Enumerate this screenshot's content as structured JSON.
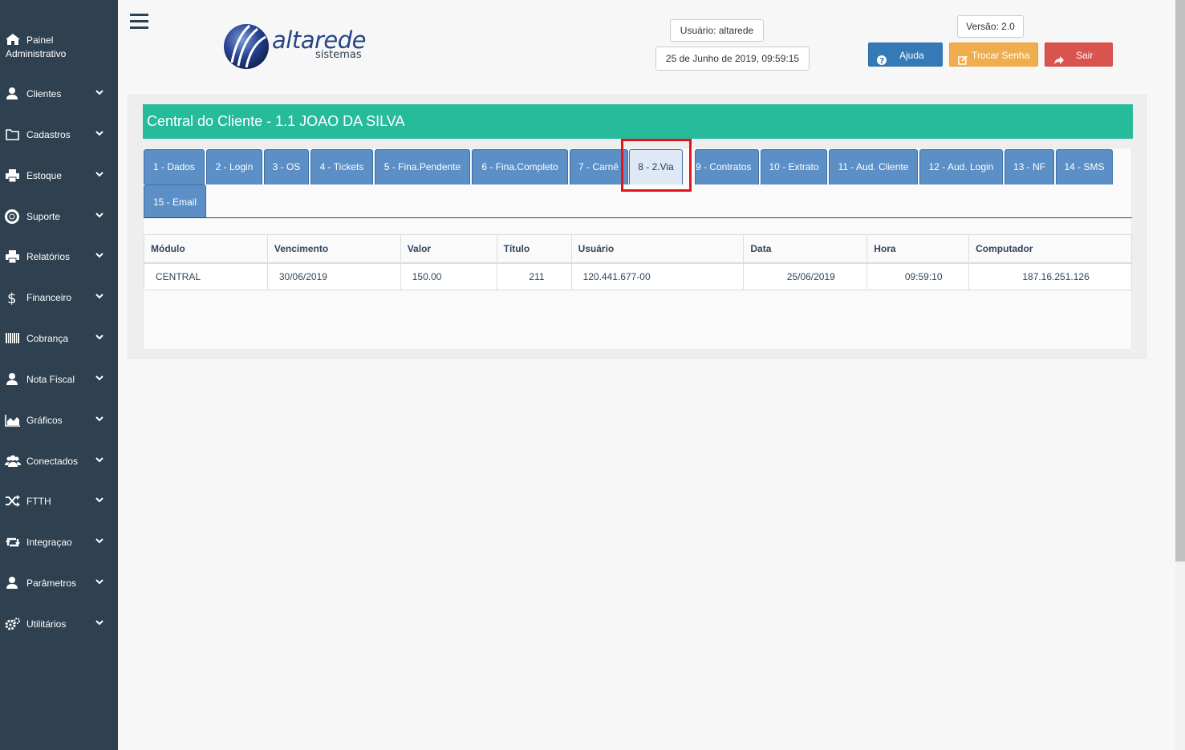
{
  "sidebar": {
    "home": {
      "line1": "Painel",
      "line2": "Administrativo",
      "icon": "home-icon"
    },
    "items": [
      {
        "label": "Clientes",
        "icon": "user-icon"
      },
      {
        "label": "Cadastros",
        "icon": "folder-icon"
      },
      {
        "label": "Estoque",
        "icon": "printer-icon"
      },
      {
        "label": "Suporte",
        "icon": "lifebuoy-icon"
      },
      {
        "label": "Relatórios",
        "icon": "printer-icon"
      },
      {
        "label": "Financeiro",
        "icon": "dollar-icon"
      },
      {
        "label": "Cobrança",
        "icon": "barcode-icon"
      },
      {
        "label": "Nota Fiscal",
        "icon": "user-icon"
      },
      {
        "label": "Gráficos",
        "icon": "area-chart-icon"
      },
      {
        "label": "Conectados",
        "icon": "users-icon"
      },
      {
        "label": "FTTH",
        "icon": "shuffle-icon"
      },
      {
        "label": "Integraçao",
        "icon": "retweet-icon"
      },
      {
        "label": "Parâmetros",
        "icon": "user-icon"
      },
      {
        "label": "Utilitários",
        "icon": "cogs-icon"
      }
    ]
  },
  "header": {
    "logo_name": "altarede",
    "logo_sub": "sistemas",
    "user": "Usuário: altarede",
    "datetime": "25 de Junho de 2019, 09:59:15",
    "version": "Versão: 2.0",
    "help_label": "Ajuda",
    "change_password_label": "Trocar Senha",
    "exit_label": "Sair"
  },
  "panel": {
    "title": "Central do Cliente - 1.1 JOAO DA SILVA",
    "tabs": [
      {
        "label": "1 - Dados"
      },
      {
        "label": "2 - Login"
      },
      {
        "label": "3 - OS"
      },
      {
        "label": "4 - Tickets"
      },
      {
        "label": "5 - Fina.Pendente"
      },
      {
        "label": "6 - Fina.Completo"
      },
      {
        "label": "7 - Carnê"
      },
      {
        "label": "8 - 2.Via",
        "active": true
      },
      {
        "label": "9 - Contratos"
      },
      {
        "label": "10 - Extrato"
      },
      {
        "label": "11 - Aud. Cliente"
      },
      {
        "label": "12 - Aud. Login"
      },
      {
        "label": "13 - NF"
      },
      {
        "label": "14 - SMS"
      },
      {
        "label": "15 - Email"
      }
    ],
    "table": {
      "headers": [
        "Módulo",
        "Vencimento",
        "Valor",
        "Título",
        "Usuário",
        "Data",
        "Hora",
        "Computador"
      ],
      "rows": [
        [
          "CENTRAL",
          "30/06/2019",
          "150.00",
          "211",
          "120.441.677-00",
          "25/06/2019",
          "09:59:10",
          "187.16.251.126"
        ]
      ]
    }
  },
  "colors": {
    "sidebar_bg": "#2f4050",
    "title_bar": "#26bb9b",
    "tab": "#5b8fc6",
    "tab_active": "#dfe9f5",
    "highlight": "#e3141b",
    "help_button": "#337ab7",
    "password_button": "#f0ad4e",
    "exit_button": "#d9534f"
  }
}
